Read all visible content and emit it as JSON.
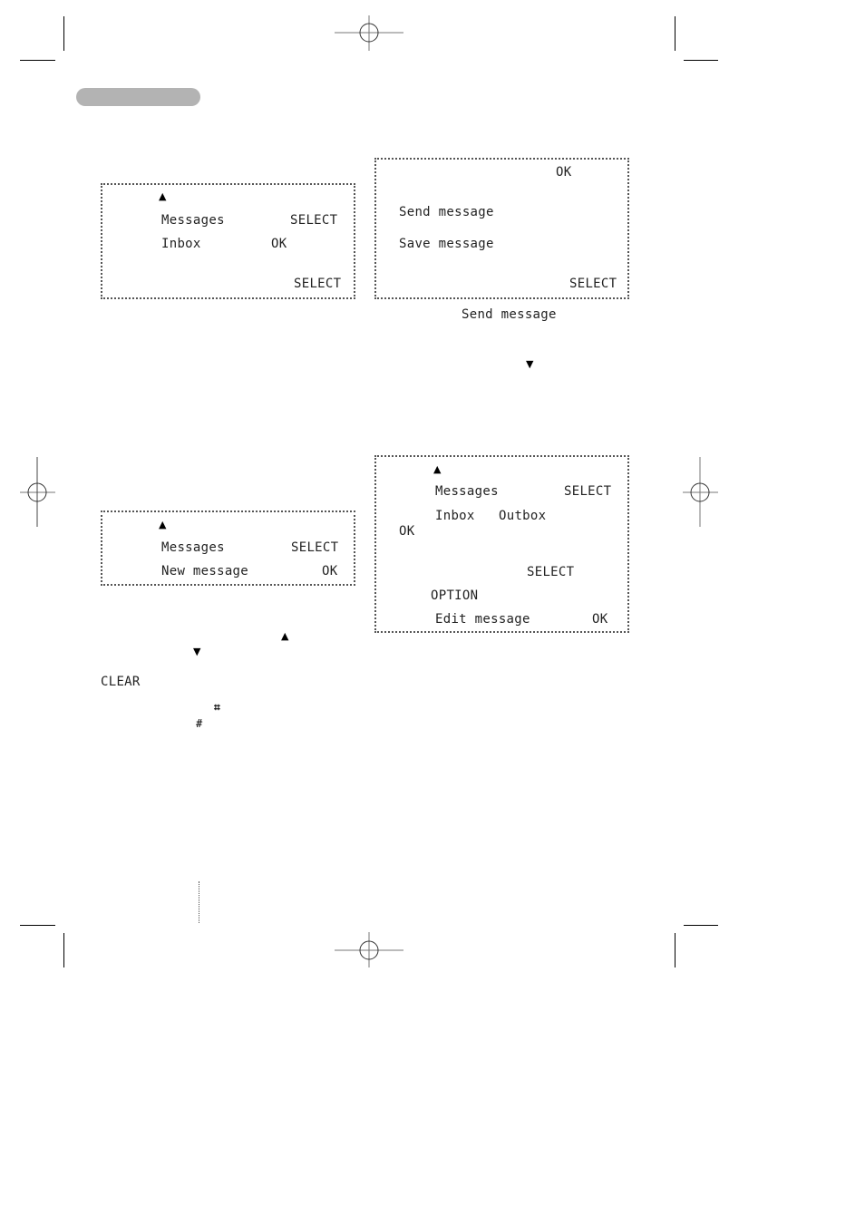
{
  "header": {
    "section_tab_color": "#b3b3b3"
  },
  "screens": [
    {
      "id": "inbox",
      "up_arrow": "▲",
      "lines": [
        {
          "text": "Messages",
          "key": "SELECT"
        },
        {
          "text": "Inbox",
          "key": "OK"
        }
      ],
      "bottom_key": "SELECT"
    },
    {
      "id": "send-save",
      "top_key": "OK",
      "lines": [
        {
          "text": "Send message"
        },
        {
          "text": "Save message"
        }
      ],
      "bottom_key": "SELECT",
      "caption": "Send message",
      "down_arrow": "▼"
    },
    {
      "id": "new-message",
      "up_arrow": "▲",
      "lines": [
        {
          "text": "Messages",
          "key": "SELECT"
        },
        {
          "text": "New message",
          "key": "OK"
        }
      ]
    },
    {
      "id": "edit-message",
      "up_arrow": "▲",
      "lines": [
        {
          "text": "Messages",
          "key": "SELECT"
        },
        {
          "text": "Inbox",
          "text2": "Outbox",
          "key": "OK"
        },
        {
          "key": "SELECT"
        },
        {
          "text": "OPTION"
        },
        {
          "text": "Edit message",
          "key": "OK"
        }
      ]
    }
  ],
  "instructions": {
    "up_arrow": "▲",
    "down_arrow": "▼",
    "clear_key": "CLEAR",
    "hash_bold": "⌗",
    "hash_plain": "#"
  }
}
